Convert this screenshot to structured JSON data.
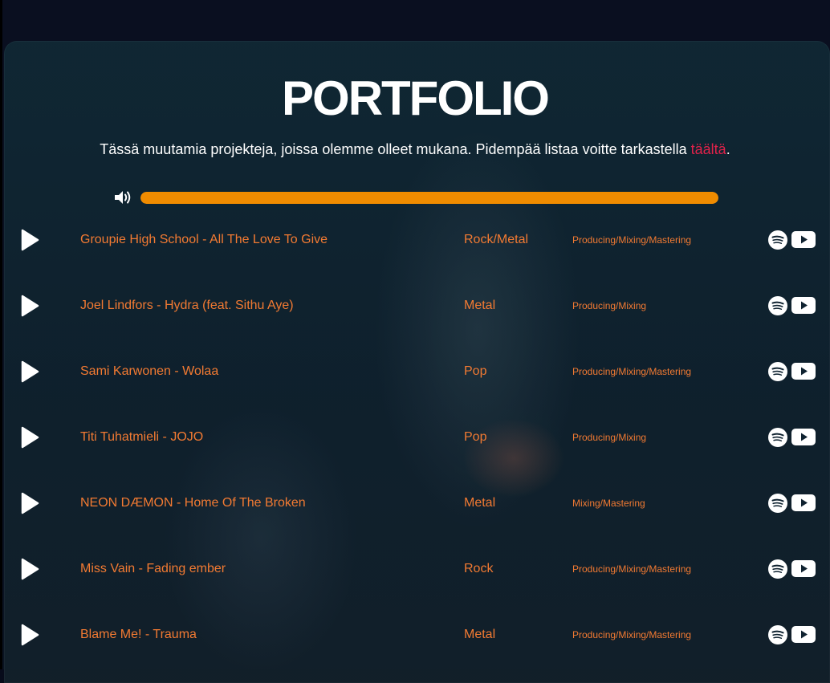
{
  "page": {
    "title": "PORTFOLIO",
    "subtitle_prefix": "Tässä muutamia projekteja, joissa olemme olleet mukana. Pidempää listaa voitte tarkastella ",
    "subtitle_link": "täältä",
    "subtitle_suffix": "."
  },
  "player": {
    "volume_icon": "volume-icon",
    "volume_level": 1.0
  },
  "colors": {
    "accent": "#f27a32",
    "volume_fill": "#f08c00",
    "link": "#e0224a",
    "text": "#ffffff"
  },
  "tracks": [
    {
      "title": "Groupie High School - All The Love To Give",
      "genre": "Rock/Metal",
      "work": "Producing/Mixing/Mastering"
    },
    {
      "title": "Joel Lindfors - Hydra (feat. Sithu Aye)",
      "genre": "Metal",
      "work": "Producing/Mixing"
    },
    {
      "title": "Sami Karwonen - Wolaa",
      "genre": "Pop",
      "work": "Producing/Mixing/Mastering"
    },
    {
      "title": "Titi Tuhatmieli - JOJO",
      "genre": "Pop",
      "work": "Producing/Mixing"
    },
    {
      "title": "NEON DÆMON - Home Of The Broken",
      "genre": "Metal",
      "work": "Mixing/Mastering"
    },
    {
      "title": "Miss Vain - Fading ember",
      "genre": "Rock",
      "work": "Producing/Mixing/Mastering"
    },
    {
      "title": "Blame Me! - Trauma",
      "genre": "Metal",
      "work": "Producing/Mixing/Mastering"
    }
  ],
  "icons": {
    "play": "play-icon",
    "spotify": "spotify-icon",
    "youtube": "youtube-icon"
  }
}
